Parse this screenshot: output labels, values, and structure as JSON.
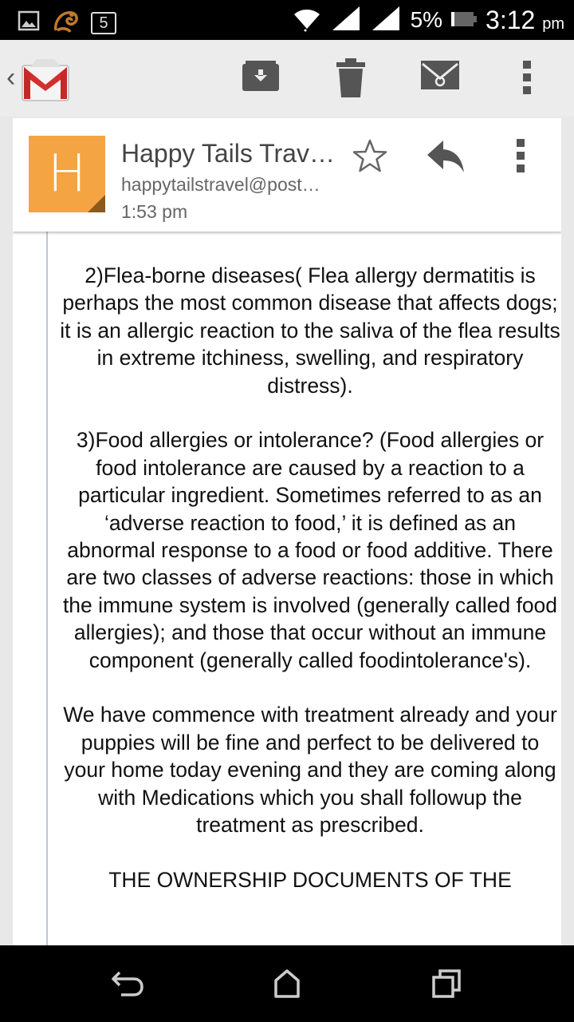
{
  "status_bar": {
    "notification_count": "5",
    "battery_percent": "5%",
    "time": "3:12",
    "time_suffix": "pm"
  },
  "action_bar": {
    "app_icon": "gmail-icon",
    "actions": [
      {
        "name": "archive",
        "icon": "archive-icon"
      },
      {
        "name": "delete",
        "icon": "trash-icon"
      },
      {
        "name": "mark-unread",
        "icon": "envelope-icon"
      },
      {
        "name": "more",
        "icon": "overflow-menu-icon"
      }
    ]
  },
  "message": {
    "avatar_letter": "H",
    "avatar_color": "#f4a442",
    "sender_name": "Happy Tails Trav…",
    "sender_email": "happytailstravel@post…",
    "time": "1:53 pm",
    "body": [
      "2)Flea-borne diseases( Flea allergy dermatitis is perhaps the most common disease that affects dogs; it is an allergic reaction to the saliva of the flea results in extreme itchiness, swelling, and respiratory distress).",
      "3)Food allergies or intolerance? (Food allergies or food intolerance are caused by a reaction to a particular ingredient. Sometimes referred to as an ‘adverse reaction to food,’ it is defined as an abnormal response to a food or food additive. There are two classes of adverse reactions: those in which the immune system is involved (generally called food allergies); and those that occur without an immune component (generally called foodintolerance's).",
      "We have commence with treatment already and your puppies will be fine and perfect to be delivered to your home today evening and they are coming along with Medications which you shall followup the treatment as prescribed.",
      "THE OWNERSHIP DOCUMENTS OF THE"
    ]
  },
  "nav_bar": {
    "buttons": [
      "back-icon",
      "home-icon",
      "recents-icon"
    ]
  }
}
